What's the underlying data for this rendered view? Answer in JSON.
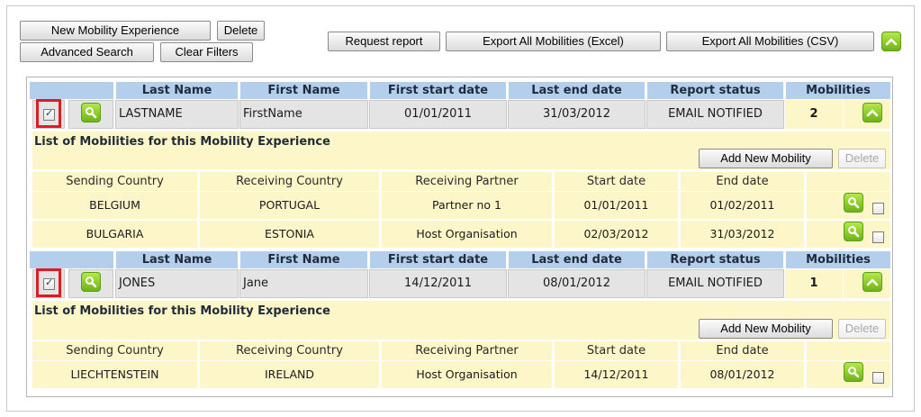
{
  "toolbar": {
    "new_mobility_experience": "New Mobility Experience",
    "delete": "Delete",
    "advanced_search": "Advanced Search",
    "clear_filters": "Clear Filters",
    "request_report": "Request report",
    "export_excel": "Export All Mobilities (Excel)",
    "export_csv": "Export All Mobilities (CSV)"
  },
  "headers": {
    "last_name": "Last Name",
    "first_name": "First Name",
    "first_start_date": "First start date",
    "last_end_date": "Last end date",
    "report_status": "Report status",
    "mobilities": "Mobilities"
  },
  "sub_headers": {
    "sending_country": "Sending Country",
    "receiving_country": "Receiving Country",
    "receiving_partner": "Receiving Partner",
    "start_date": "Start date",
    "end_date": "End date"
  },
  "list_title": "List of Mobilities for this Mobility Experience",
  "add_new_mobility": "Add New Mobility",
  "delete_label": "Delete",
  "experiences": [
    {
      "last_name": "LASTNAME",
      "first_name": "FirstName",
      "first_start_date": "01/01/2011",
      "last_end_date": "31/03/2012",
      "report_status": "EMAIL NOTIFIED",
      "mobilities_count": "2",
      "mobilities": [
        {
          "sending_country": "BELGIUM",
          "receiving_country": "PORTUGAL",
          "receiving_partner": "Partner no 1",
          "start_date": "01/01/2011",
          "end_date": "01/02/2011"
        },
        {
          "sending_country": "BULGARIA",
          "receiving_country": "ESTONIA",
          "receiving_partner": "Host Organisation",
          "start_date": "02/03/2012",
          "end_date": "31/03/2012"
        }
      ]
    },
    {
      "last_name": "JONES",
      "first_name": "Jane",
      "first_start_date": "14/12/2011",
      "last_end_date": "08/01/2012",
      "report_status": "EMAIL NOTIFIED",
      "mobilities_count": "1",
      "mobilities": [
        {
          "sending_country": "LIECHTENSTEIN",
          "receiving_country": "IRELAND",
          "receiving_partner": "Host Organisation",
          "start_date": "14/12/2011",
          "end_date": "08/01/2012"
        }
      ]
    }
  ],
  "colors": {
    "header_blue": "#b3cfec",
    "row_yellow": "#fdf6c8",
    "cell_grey": "#e4e4e4",
    "accent_green": "#8bcf2a",
    "highlight_red": "#e01b22"
  },
  "icons": {
    "collapse": "chevron-up-icon",
    "view": "magnifier-icon"
  }
}
